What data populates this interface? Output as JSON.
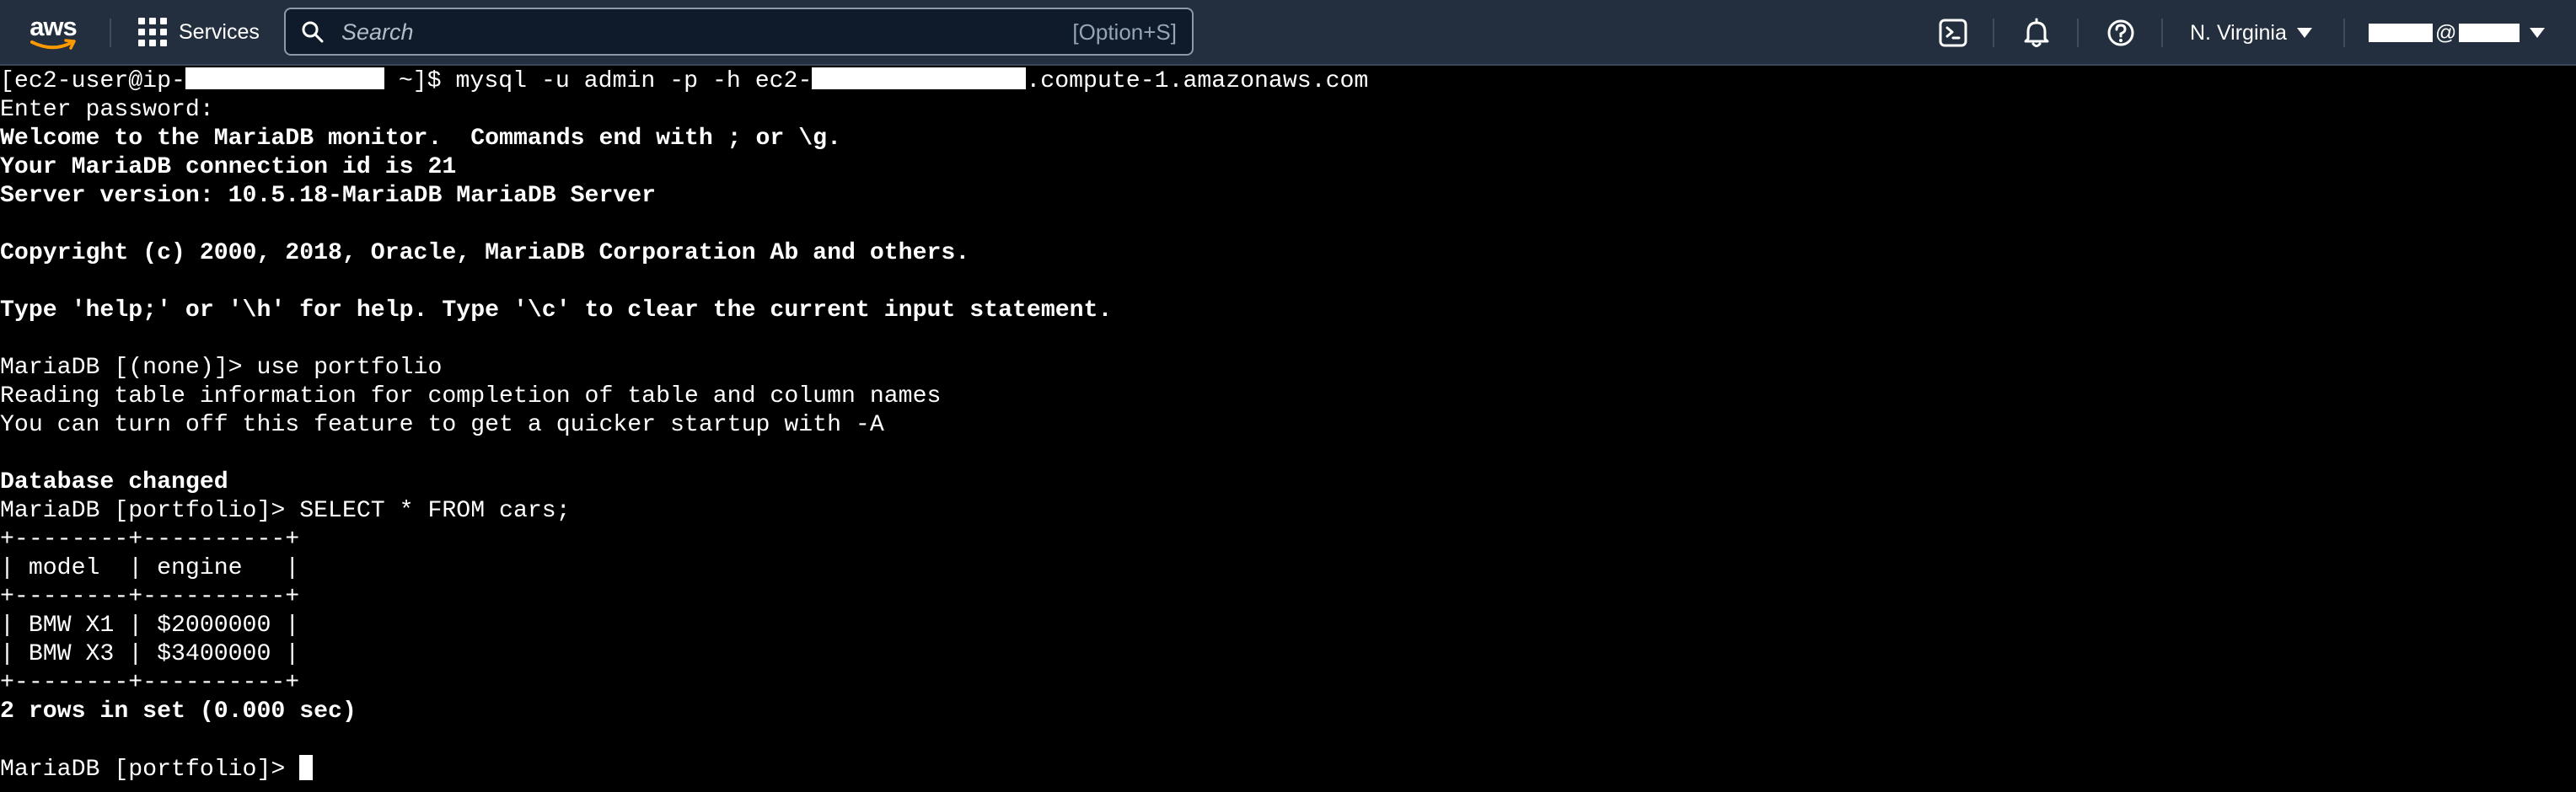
{
  "nav": {
    "logo_text": "aws",
    "services_label": "Services",
    "search": {
      "placeholder": "Search",
      "shortcut": "[Option+S]"
    },
    "icons": [
      "cloudshell-icon",
      "notifications-bell-icon",
      "help-icon"
    ],
    "region_label": "N. Virginia",
    "account_separator": "@",
    "colors": {
      "bar": "#232f3e",
      "accent_smile": "#ff9900"
    }
  },
  "terminal": {
    "lines": [
      {
        "type": "command",
        "prompt_start": "[ec2-user@ip-",
        "prompt_end": " ~]$ ",
        "command_start": "mysql -u admin -p -h ec2-",
        "command_end": ".compute-1.amazonaws.com"
      },
      {
        "type": "text",
        "text": "Enter password:",
        "bold": false
      },
      {
        "type": "text",
        "text": "Welcome to the MariaDB monitor.  Commands end with ; or \\g.",
        "bold": true
      },
      {
        "type": "text",
        "text": "Your MariaDB connection id is 21",
        "bold": true
      },
      {
        "type": "text",
        "text": "Server version: 10.5.18-MariaDB MariaDB Server",
        "bold": true
      },
      {
        "type": "text",
        "text": "",
        "bold": false
      },
      {
        "type": "text",
        "text": "Copyright (c) 2000, 2018, Oracle, MariaDB Corporation Ab and others.",
        "bold": true
      },
      {
        "type": "text",
        "text": "",
        "bold": false
      },
      {
        "type": "text",
        "text": "Type 'help;' or '\\h' for help. Type '\\c' to clear the current input statement.",
        "bold": true
      },
      {
        "type": "text",
        "text": "",
        "bold": false
      },
      {
        "type": "text",
        "text": "MariaDB [(none)]> use portfolio",
        "bold": false
      },
      {
        "type": "text",
        "text": "Reading table information for completion of table and column names",
        "bold": false
      },
      {
        "type": "text",
        "text": "You can turn off this feature to get a quicker startup with -A",
        "bold": false
      },
      {
        "type": "text",
        "text": "",
        "bold": false
      },
      {
        "type": "text",
        "text": "Database changed",
        "bold": true
      },
      {
        "type": "text",
        "text": "MariaDB [portfolio]> SELECT * FROM cars;",
        "bold": false
      },
      {
        "type": "text",
        "text": "+--------+----------+",
        "bold": false
      },
      {
        "type": "text",
        "text": "| model  | engine   |",
        "bold": false
      },
      {
        "type": "text",
        "text": "+--------+----------+",
        "bold": false
      },
      {
        "type": "text",
        "text": "| BMW X1 | $2000000 |",
        "bold": false
      },
      {
        "type": "text",
        "text": "| BMW X3 | $3400000 |",
        "bold": false
      },
      {
        "type": "text",
        "text": "+--------+----------+",
        "bold": false
      },
      {
        "type": "text",
        "text": "2 rows in set (0.000 sec)",
        "bold": true
      },
      {
        "type": "text",
        "text": "",
        "bold": false
      },
      {
        "type": "prompt",
        "text": "MariaDB [portfolio]> "
      }
    ]
  }
}
